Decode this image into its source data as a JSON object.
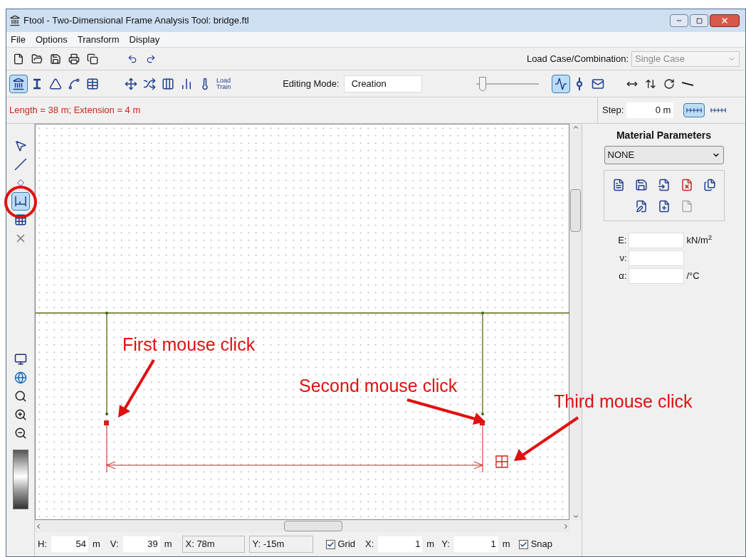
{
  "window": {
    "title": "Ftool - Two-Dimensional Frame Analysis Tool: bridge.ftl"
  },
  "menu": [
    {
      "label": "File"
    },
    {
      "label": "Options"
    },
    {
      "label": "Transform"
    },
    {
      "label": "Display"
    }
  ],
  "load_case": {
    "label": "Load Case/Combination:",
    "value": "Single Case",
    "disabled": true
  },
  "object_tools": [
    {
      "selected": true
    },
    {
      "selected": false
    },
    {
      "selected": false
    },
    {
      "selected": false
    },
    {
      "selected": false
    }
  ],
  "load_tools": [
    {
      "selected": false
    },
    {
      "selected": false
    },
    {
      "selected": false
    },
    {
      "selected": false
    },
    {
      "selected": false
    }
  ],
  "load_train": {
    "lines": [
      "Load",
      "Train"
    ]
  },
  "editing_mode": {
    "label": "Editing Mode:",
    "value": "Creation"
  },
  "slider": {
    "level": 0.05
  },
  "view_tools": [
    {
      "selected": true
    },
    {
      "selected": false
    },
    {
      "selected": false
    }
  ],
  "info": {
    "message": "Length = 38 m; Extension = 4 m",
    "step_label": "Step:",
    "step_value": "0 m",
    "scale_buttons": [
      {
        "selected": true
      },
      {
        "selected": false
      }
    ]
  },
  "left_tools": [
    {
      "selected": false
    },
    {
      "selected": false
    },
    {
      "selected": false
    },
    {
      "selected": true
    },
    {
      "selected": false
    },
    {
      "selected": false
    }
  ],
  "material": {
    "title": "Material Parameters",
    "dropdown": "NONE",
    "fields": [
      {
        "label": "E:",
        "unit": "kN/m$^{2}$"
      },
      {
        "label": "ν:"
      },
      {
        "label": "α:",
        "unit": "/°C"
      }
    ]
  },
  "status": {
    "h_label": "H:",
    "h_value": "54",
    "h_unit": "m",
    "v_label": "V:",
    "v_value": "39",
    "v_unit": "m",
    "x_reading": "X: 78m",
    "y_reading": "Y: -15m",
    "grid": {
      "label": "Grid",
      "checked": true
    },
    "grid_x_label": "X:",
    "grid_x_value": "1",
    "grid_x_unit": "m",
    "grid_y_label": "Y:",
    "grid_y_value": "1",
    "grid_y_unit": "m",
    "snap": {
      "label": "Snap",
      "checked": true
    }
  },
  "annotations": [
    {
      "text": "First mouse click"
    },
    {
      "text": "Second mouse click"
    },
    {
      "text": "Third mouse click"
    }
  ]
}
